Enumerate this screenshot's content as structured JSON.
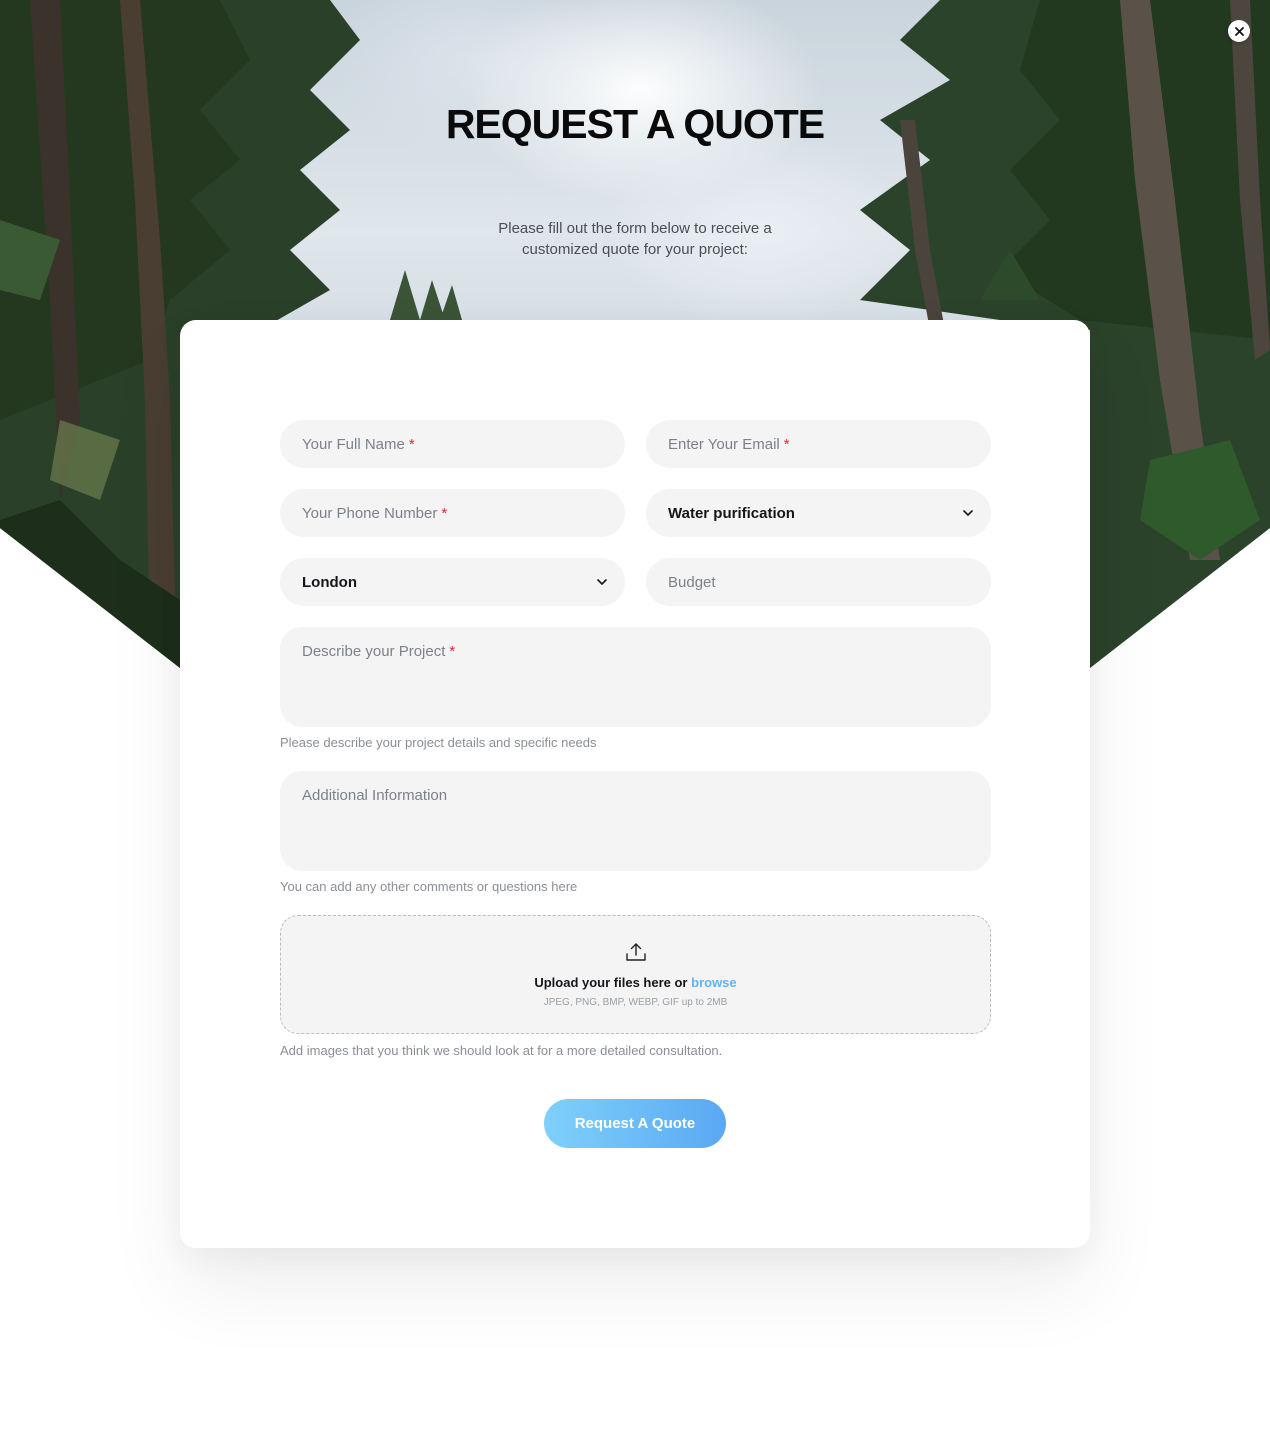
{
  "header": {
    "title": "REQUEST A QUOTE",
    "subtitle": "Please fill out the form below to receive a customized quote for your project:"
  },
  "form": {
    "full_name_placeholder": "Your Full Name",
    "email_placeholder": "Enter Your Email",
    "phone_placeholder": "Your Phone Number",
    "service_selected": "Water purification",
    "location_selected": "London",
    "budget_placeholder": "Budget",
    "project_placeholder": "Describe  your Project",
    "project_help": "Please describe your project details and specific needs",
    "additional_placeholder": "Additional Information",
    "additional_help": "You can add any other comments or questions here",
    "required_mark": "*"
  },
  "upload": {
    "main_text": "Upload your files here or",
    "browse_label": "browse",
    "types": "JPEG, PNG, BMP, WEBP, GIF up to 2MB",
    "help": "Add images that you think we should look at for a more detailed consultation."
  },
  "submit_label": "Request A Quote",
  "icons": {
    "close": "close-icon",
    "chevron": "chevron-down-icon",
    "upload": "upload-icon"
  },
  "colors": {
    "accent": "#5fb3ff",
    "button_gradient_start": "#7fd0fb",
    "button_gradient_end": "#5aa8f3",
    "required": "#e02434",
    "field_bg": "#f4f4f4"
  }
}
